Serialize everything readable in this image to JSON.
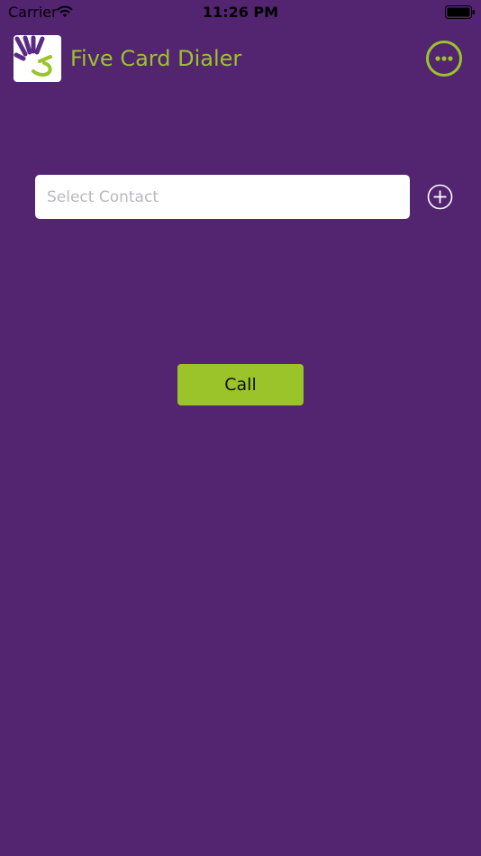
{
  "status_bar": {
    "carrier": "Carrier",
    "time": "11:26 PM",
    "wifi_icon": "wifi-icon",
    "battery_icon": "battery-icon"
  },
  "header": {
    "title": "Five Card Dialer",
    "logo_icon": "app-logo-icon",
    "more_icon": "more-options-icon"
  },
  "contact": {
    "placeholder": "Select Contact",
    "value": "",
    "add_icon": "plus-circle-icon"
  },
  "call_button": {
    "label": "Call"
  },
  "colors": {
    "background": "#532470",
    "accent": "#9ac42a",
    "input_background": "#ffffff",
    "placeholder": "#b9b9bf"
  }
}
